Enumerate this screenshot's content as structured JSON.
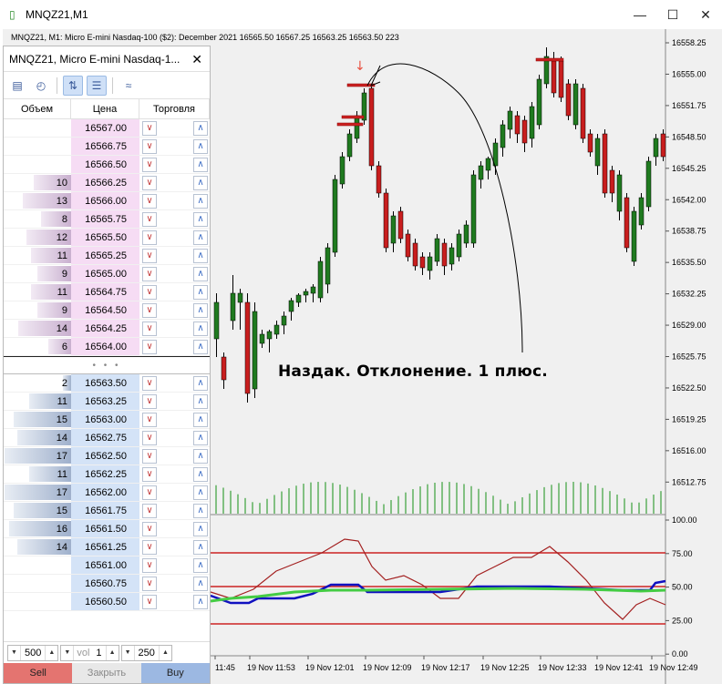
{
  "window": {
    "title": "MNQZ21,M1",
    "minimize": "—",
    "maximize": "☐",
    "close": "✕"
  },
  "chart": {
    "header_text": "MNQZ21, M1:  Micro E-mini Nasdaq-100 ($2): December 2021   16565.50  16567.25  16563.25  16563.50  223",
    "price_ticks": [
      "16558.25",
      "16555.00",
      "16551.75",
      "16548.50",
      "16545.25",
      "16542.00",
      "16538.75",
      "16535.50",
      "16532.25",
      "16529.00",
      "16525.75",
      "16522.50",
      "16519.25",
      "16516.00",
      "16512.75"
    ],
    "osc_ticks": [
      "100.00",
      "75.00",
      "50.00",
      "25.00",
      "0.00"
    ],
    "time_ticks": [
      "11:45",
      "19 Nov 11:53",
      "19 Nov 12:01",
      "19 Nov 12:09",
      "19 Nov 12:17",
      "19 Nov 12:25",
      "19 Nov 12:33",
      "19 Nov 12:41",
      "19 Nov 12:49"
    ],
    "annotation": "Наздак. Отклонение.  1 плюс.",
    "colors": {
      "bull": "#1f7a1f",
      "bear": "#c81e1e",
      "volume": "#3aa03a",
      "level": "#cc2222",
      "osc_red": "#a32020",
      "osc_blue": "#1010c0",
      "osc_green": "#44cc44"
    }
  },
  "dom": {
    "title": "MNQZ21, Micro E-mini Nasdaq-1...",
    "close_label": "✕",
    "headers": {
      "volume": "Объем",
      "price": "Цена",
      "trade": "Торговля"
    },
    "asks": [
      {
        "vol": "",
        "price": "16567.00",
        "fill": 0
      },
      {
        "vol": "",
        "price": "16566.75",
        "fill": 0
      },
      {
        "vol": "",
        "price": "16566.50",
        "fill": 0
      },
      {
        "vol": "10",
        "price": "16566.25",
        "fill": 0.55
      },
      {
        "vol": "13",
        "price": "16566.00",
        "fill": 0.72
      },
      {
        "vol": "8",
        "price": "16565.75",
        "fill": 0.45
      },
      {
        "vol": "12",
        "price": "16565.50",
        "fill": 0.66
      },
      {
        "vol": "11",
        "price": "16565.25",
        "fill": 0.6
      },
      {
        "vol": "9",
        "price": "16565.00",
        "fill": 0.5
      },
      {
        "vol": "11",
        "price": "16564.75",
        "fill": 0.6
      },
      {
        "vol": "9",
        "price": "16564.50",
        "fill": 0.5
      },
      {
        "vol": "14",
        "price": "16564.25",
        "fill": 0.78
      },
      {
        "vol": "6",
        "price": "16564.00",
        "fill": 0.34
      }
    ],
    "separator": "• • •",
    "bids": [
      {
        "vol": "2",
        "price": "16563.50",
        "fill": 0.12
      },
      {
        "vol": "11",
        "price": "16563.25",
        "fill": 0.62
      },
      {
        "vol": "15",
        "price": "16563.00",
        "fill": 0.85
      },
      {
        "vol": "14",
        "price": "16562.75",
        "fill": 0.8
      },
      {
        "vol": "17",
        "price": "16562.50",
        "fill": 0.98
      },
      {
        "vol": "11",
        "price": "16562.25",
        "fill": 0.62
      },
      {
        "vol": "17",
        "price": "16562.00",
        "fill": 0.98
      },
      {
        "vol": "15",
        "price": "16561.75",
        "fill": 0.85
      },
      {
        "vol": "16",
        "price": "16561.50",
        "fill": 0.92
      },
      {
        "vol": "14",
        "price": "16561.25",
        "fill": 0.8
      },
      {
        "vol": "",
        "price": "16561.00",
        "fill": 0
      },
      {
        "vol": "",
        "price": "16560.75",
        "fill": 0
      },
      {
        "vol": "",
        "price": "16560.50",
        "fill": 0
      }
    ],
    "controls": {
      "qty1": "500",
      "vol_label": "vol",
      "vol": "1",
      "qty2": "250"
    },
    "actions": {
      "sell": "Sell",
      "close": "Закрыть",
      "buy": "Buy"
    }
  }
}
